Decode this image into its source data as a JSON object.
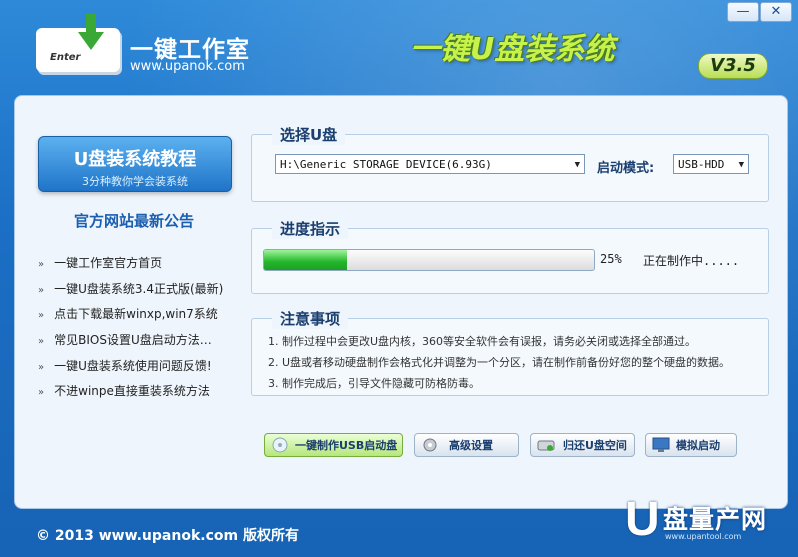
{
  "brand": {
    "name": "一键工作室",
    "url": "www.upanok.com",
    "key_label": "Enter"
  },
  "app": {
    "title": "一键U盘装系统",
    "version": "V3.5"
  },
  "window_controls": {
    "minimize": "—",
    "close": "✕"
  },
  "sidebar": {
    "tutorial_title": "U盘装系统教程",
    "tutorial_sub": "3分种教你学会装系统",
    "notice_title": "官方网站最新公告",
    "links": [
      "一键工作室官方首页",
      "一键U盘装系统3.4正式版(最新)",
      "点击下载最新winxp,win7系统",
      "常见BIOS设置U盘启动方法…",
      "一键U盘装系统使用问题反馈!",
      "不进winpe直接重装系统方法"
    ],
    "bullet": "»"
  },
  "select_disk": {
    "title": "选择U盘",
    "device_value": "H:\\Generic STORAGE DEVICE(6.93G)",
    "boot_mode_label": "启动模式:",
    "boot_mode_value": "USB-HDD"
  },
  "progress": {
    "title": "进度指示",
    "percent": 25,
    "percent_text": "25%",
    "status": "正在制作中....."
  },
  "notes": {
    "title": "注意事项",
    "items": [
      "1. 制作过程中会更改U盘内核，360等安全软件会有误报，请务必关闭或选择全部通过。",
      "2. U盘或者移动硬盘制作会格式化并调整为一个分区，请在制作前备份好您的整个硬盘的数据。",
      "3. 制作完成后，引导文件隐藏可防格防毒。"
    ]
  },
  "actions": {
    "make": "一键制作USB启动盘",
    "advanced": "高级设置",
    "restore": "归还U盘空间",
    "simulate": "模拟启动"
  },
  "footer": {
    "copyright": "© 2013 www.upanok.com  版权所有"
  },
  "watermark": {
    "letter": "U",
    "text": "盘量产网",
    "sub": "www.upantool.com"
  },
  "colors": {
    "accent_green": "#c6f24a",
    "progress_green": "#22b52a",
    "bg_blue": "#1b6fc4"
  }
}
